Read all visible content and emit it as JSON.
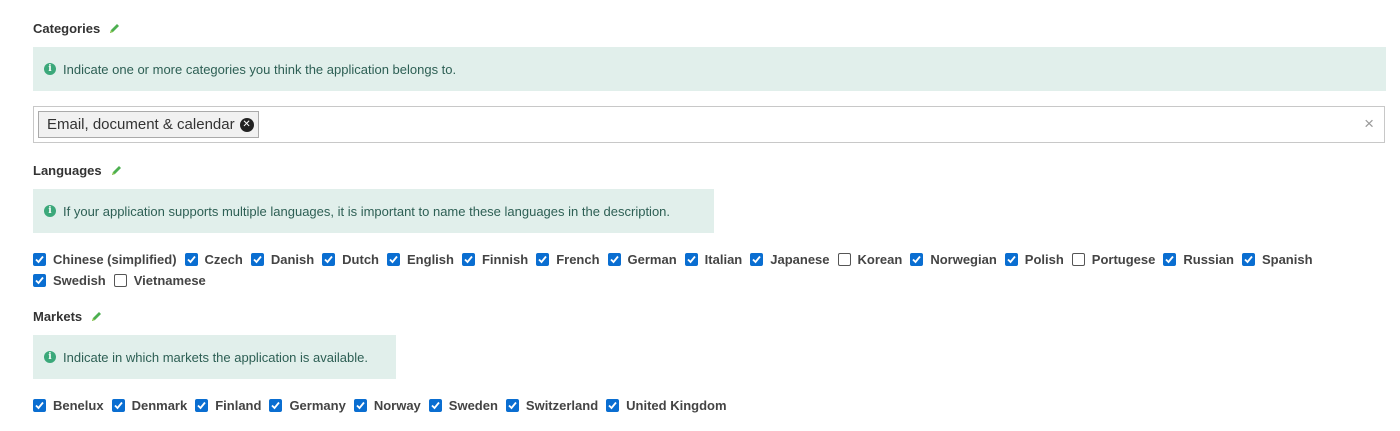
{
  "categories": {
    "title": "Categories",
    "info": "Indicate one or more categories you think the application belongs to.",
    "selected": [
      "Email, document & calendar"
    ],
    "clear_icon": "×"
  },
  "languages": {
    "title": "Languages",
    "info": "If your application supports multiple languages, it is important to name these languages in the description.",
    "items": [
      {
        "label": "Chinese (simplified)",
        "checked": true
      },
      {
        "label": "Czech",
        "checked": true
      },
      {
        "label": "Danish",
        "checked": true
      },
      {
        "label": "Dutch",
        "checked": true
      },
      {
        "label": "English",
        "checked": true
      },
      {
        "label": "Finnish",
        "checked": true
      },
      {
        "label": "French",
        "checked": true
      },
      {
        "label": "German",
        "checked": true
      },
      {
        "label": "Italian",
        "checked": true
      },
      {
        "label": "Japanese",
        "checked": true
      },
      {
        "label": "Korean",
        "checked": false
      },
      {
        "label": "Norwegian",
        "checked": true
      },
      {
        "label": "Polish",
        "checked": true
      },
      {
        "label": "Portugese",
        "checked": false
      },
      {
        "label": "Russian",
        "checked": true
      },
      {
        "label": "Spanish",
        "checked": true
      },
      {
        "label": "Swedish",
        "checked": true
      },
      {
        "label": "Vietnamese",
        "checked": false
      }
    ]
  },
  "markets": {
    "title": "Markets",
    "info": "Indicate in which markets the application is available.",
    "items": [
      {
        "label": "Benelux",
        "checked": true
      },
      {
        "label": "Denmark",
        "checked": true
      },
      {
        "label": "Finland",
        "checked": true
      },
      {
        "label": "Germany",
        "checked": true
      },
      {
        "label": "Norway",
        "checked": true
      },
      {
        "label": "Sweden",
        "checked": true
      },
      {
        "label": "Switzerland",
        "checked": true
      },
      {
        "label": "United Kingdom",
        "checked": true
      }
    ]
  },
  "colors": {
    "checkbox_checked": "#0a6ed1",
    "info_background": "#e1efeb",
    "info_icon": "#3ba87a",
    "edit_icon": "#4caf50"
  },
  "icons": {
    "edit": "pencil-icon",
    "info": "info-icon",
    "remove": "remove-circle-icon",
    "clear": "close-icon"
  }
}
